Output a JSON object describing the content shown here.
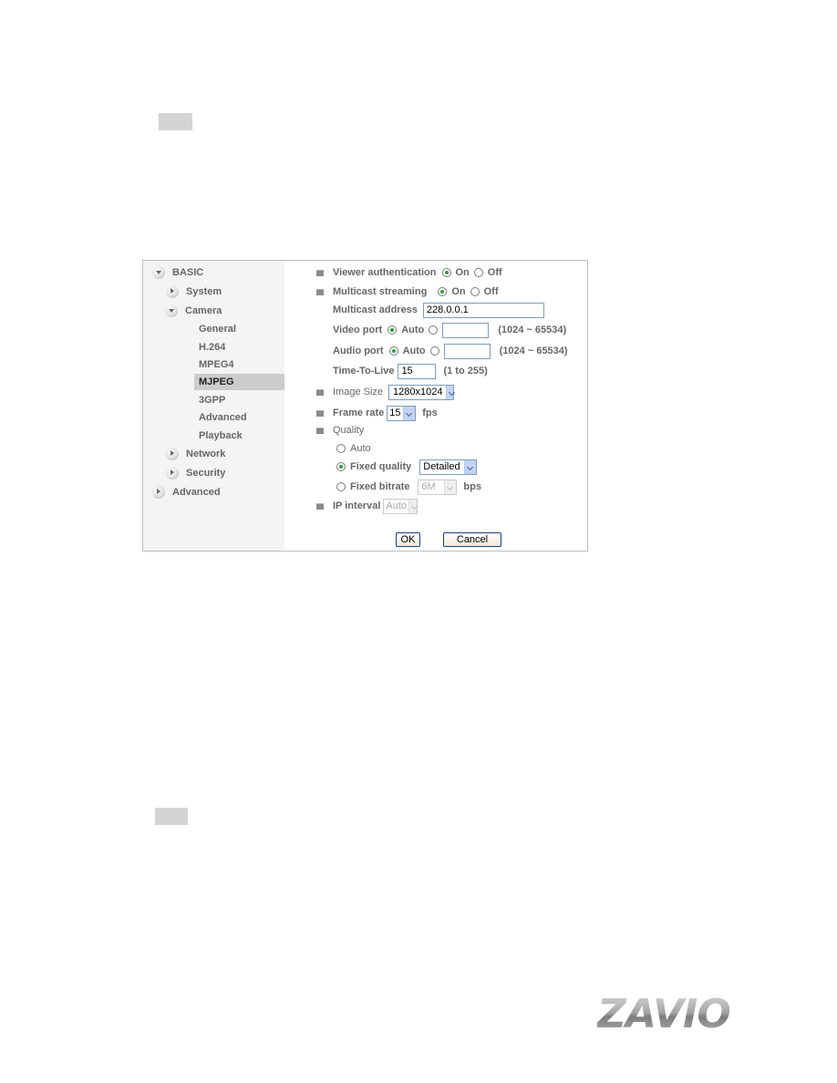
{
  "sidebar": {
    "items": [
      {
        "label": "BASIC",
        "icon": "expanded-arrow-icon",
        "level": 0
      },
      {
        "label": "System",
        "icon": "collapsed-arrow-icon",
        "level": 1
      },
      {
        "label": "Camera",
        "icon": "expanded-arrow-icon",
        "level": 1
      },
      {
        "label": "General",
        "level": 2
      },
      {
        "label": "H.264",
        "level": 2
      },
      {
        "label": "MPEG4",
        "level": 2
      },
      {
        "label": "MJPEG",
        "level": 2,
        "selected": true
      },
      {
        "label": "3GPP",
        "level": 2
      },
      {
        "label": "Advanced",
        "level": 2
      },
      {
        "label": "Playback",
        "level": 2
      },
      {
        "label": "Network",
        "icon": "collapsed-arrow-icon",
        "level": 1
      },
      {
        "label": "Security",
        "icon": "collapsed-arrow-icon",
        "level": 1
      },
      {
        "label": "Advanced",
        "icon": "collapsed-arrow-icon",
        "level": 0
      }
    ]
  },
  "form": {
    "viewer_auth": {
      "label": "Viewer authentication",
      "on": "On",
      "off": "Off",
      "value": "On"
    },
    "multicast": {
      "label": "Multicast streaming",
      "on": "On",
      "off": "Off",
      "value": "On"
    },
    "multicast_address": {
      "label": "Multicast address",
      "value": "228.0.0.1"
    },
    "video_port": {
      "label": "Video port",
      "auto": "Auto",
      "value": "",
      "range": "(1024 ~ 65534)",
      "selected": "Auto"
    },
    "audio_port": {
      "label": "Audio port",
      "auto": "Auto",
      "value": "",
      "range": "(1024 ~ 65534)",
      "selected": "Auto"
    },
    "ttl": {
      "label": "Time-To-Live",
      "value": "15",
      "range": "(1 to 255)"
    },
    "image_size": {
      "label": "Image Size",
      "value": "1280x1024"
    },
    "frame_rate": {
      "label": "Frame rate",
      "value": "15",
      "unit": "fps"
    },
    "quality": {
      "label": "Quality",
      "auto": "Auto",
      "fixed_quality": {
        "label": "Fixed quality",
        "value": "Detailed"
      },
      "fixed_bitrate": {
        "label": "Fixed bitrate",
        "value": "6M",
        "unit": "bps"
      },
      "selected": "Fixed quality"
    },
    "ip_interval": {
      "label": "IP interval",
      "value": "Auto"
    }
  },
  "buttons": {
    "ok": "OK",
    "cancel": "Cancel"
  },
  "logo": {
    "text": "ZAVIO"
  }
}
